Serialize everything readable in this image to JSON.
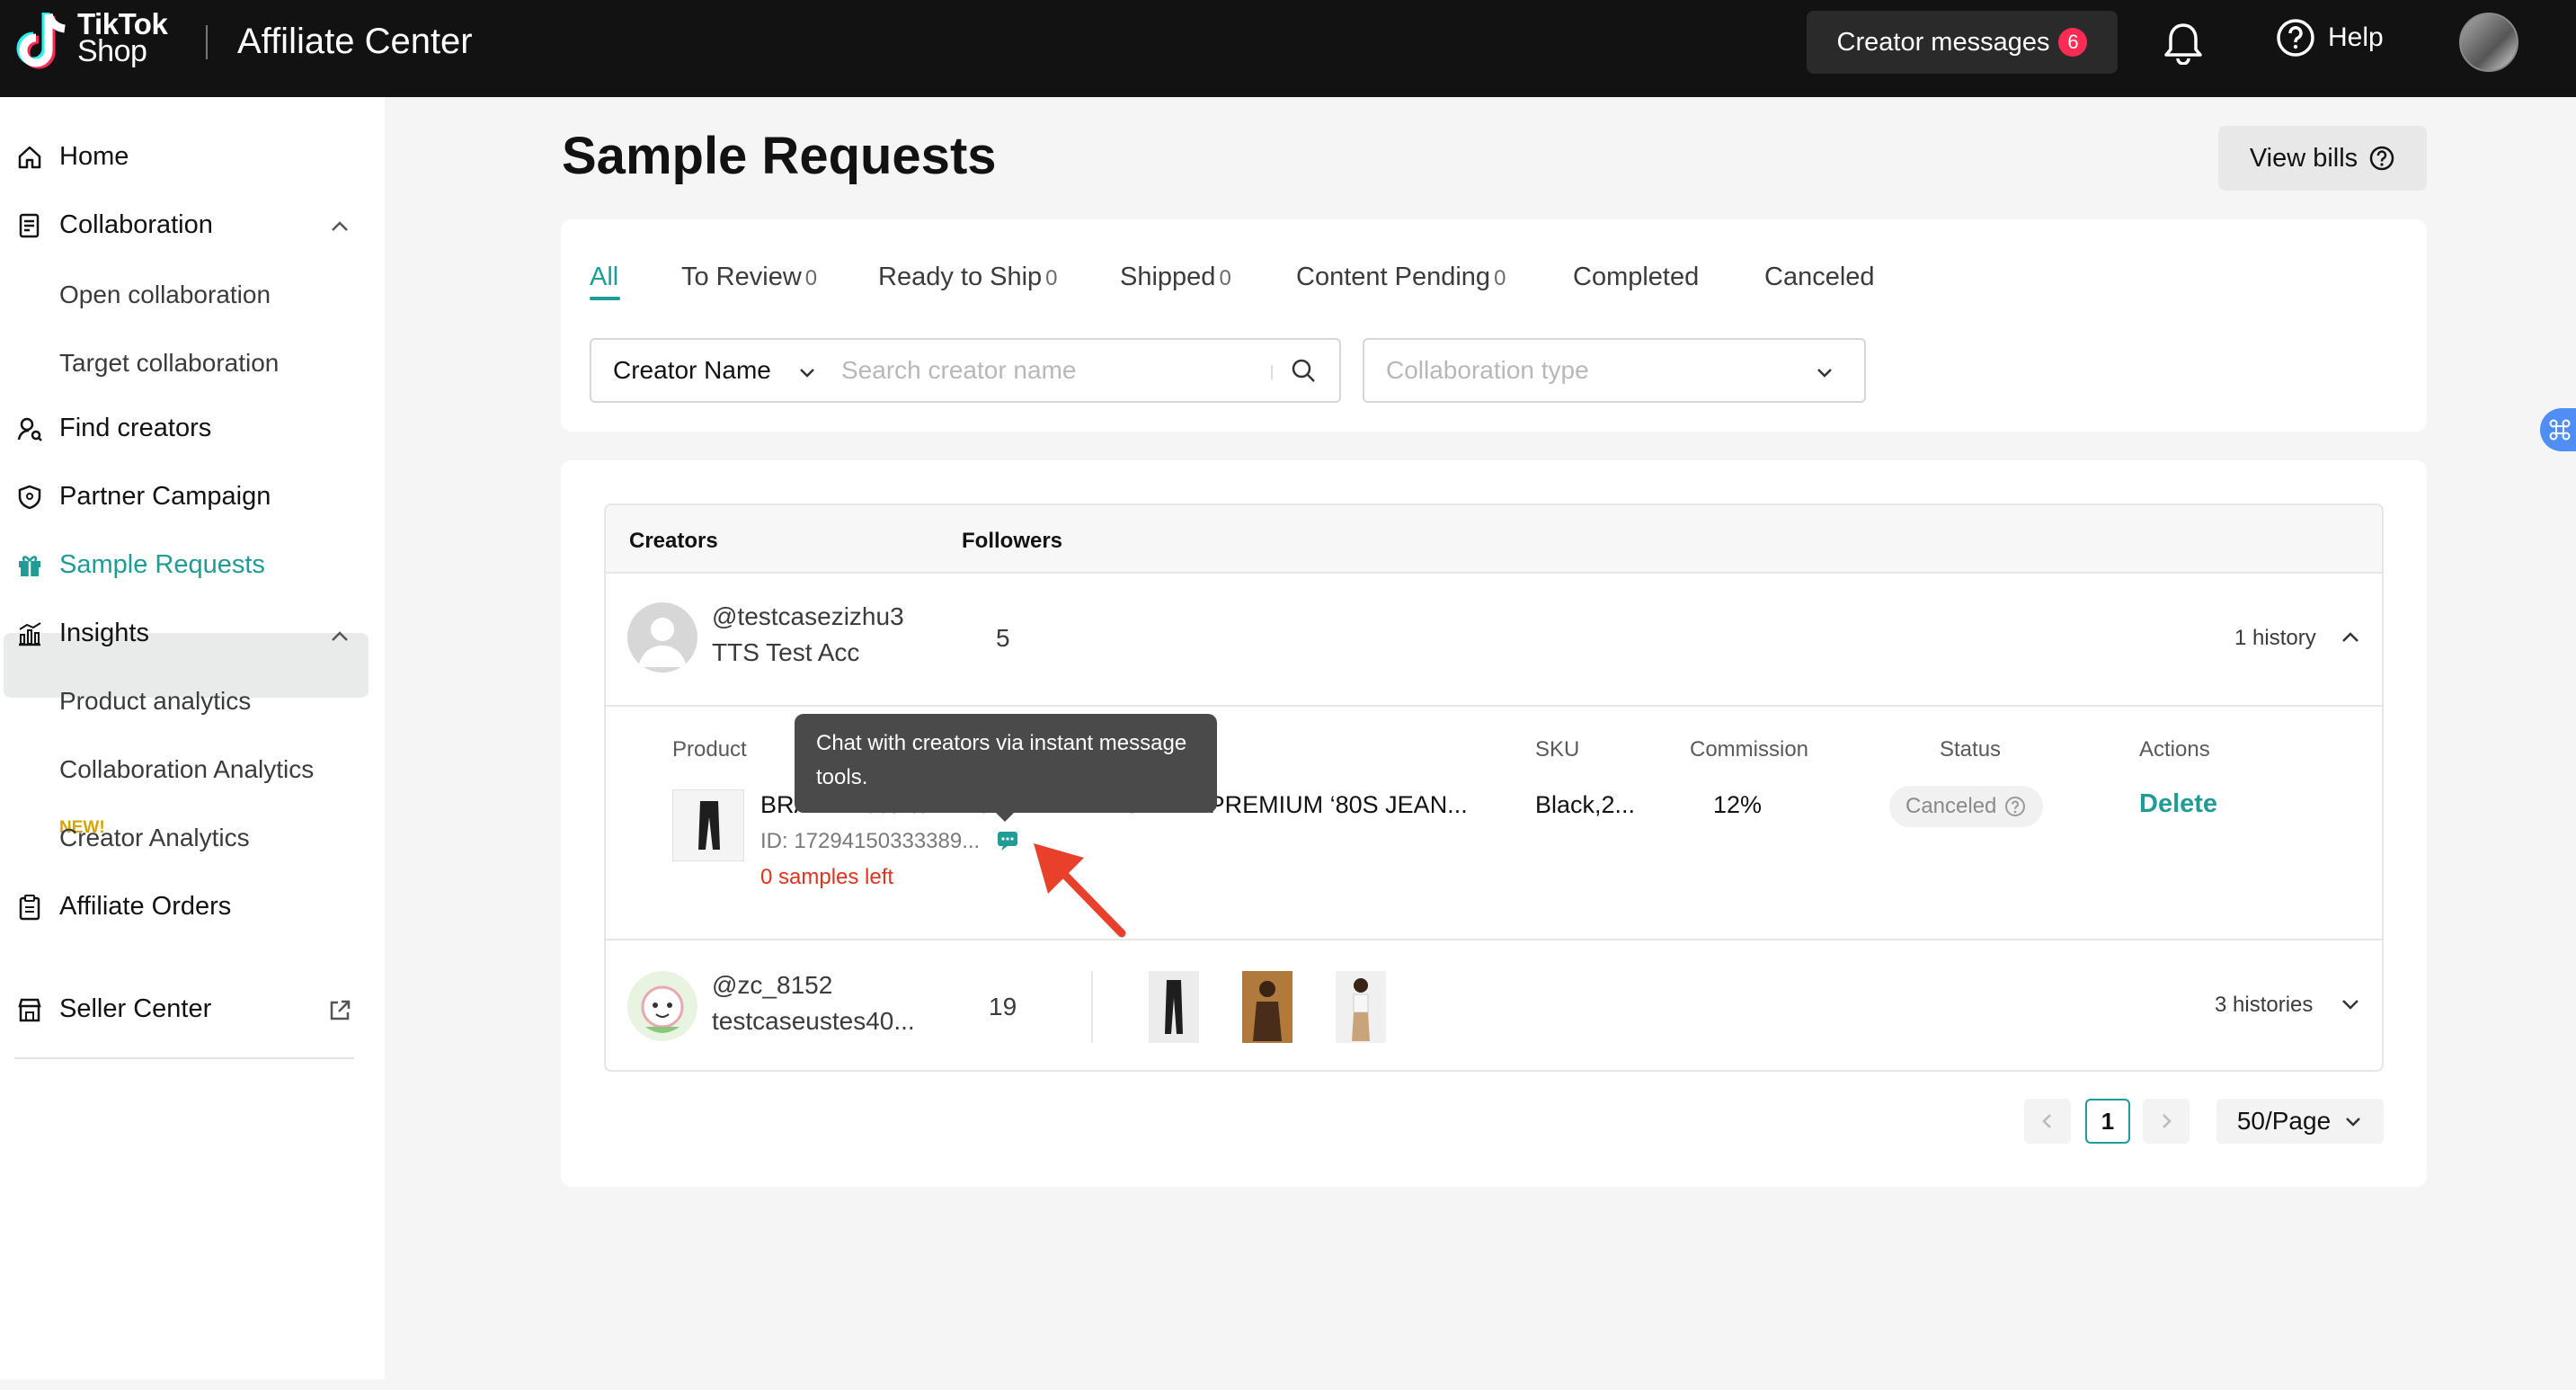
{
  "topbar": {
    "logo_line1": "TikTok",
    "logo_line2": "Shop",
    "app_title": "Affiliate Center",
    "creator_messages_label": "Creator messages",
    "creator_messages_count": "6",
    "help_label": "Help"
  },
  "sidebar": {
    "home": "Home",
    "collaboration": "Collaboration",
    "open_collaboration": "Open collaboration",
    "target_collaboration": "Target collaboration",
    "find_creators": "Find creators",
    "partner_campaign": "Partner Campaign",
    "sample_requests": "Sample Requests",
    "insights": "Insights",
    "product_analytics": "Product analytics",
    "new_tag": "NEW!",
    "collaboration_analytics": "Collaboration Analytics",
    "creator_analytics": "Creator Analytics",
    "affiliate_orders": "Affiliate Orders",
    "seller_center": "Seller Center"
  },
  "page": {
    "title": "Sample Requests",
    "view_bills": "View bills"
  },
  "tabs": [
    {
      "label": "All",
      "count": ""
    },
    {
      "label": "To Review",
      "count": "0"
    },
    {
      "label": "Ready to Ship",
      "count": "0"
    },
    {
      "label": "Shipped",
      "count": "0"
    },
    {
      "label": "Content Pending",
      "count": "0"
    },
    {
      "label": "Completed",
      "count": ""
    },
    {
      "label": "Canceled",
      "count": ""
    }
  ],
  "filters": {
    "creator_select": "Creator Name",
    "search_placeholder": "Search creator name",
    "collab_type_placeholder": "Collaboration type"
  },
  "table": {
    "col_creators": "Creators",
    "col_followers": "Followers",
    "rows": [
      {
        "handle": "@testcasezizhu3",
        "name": "TTS Test Acc",
        "followers": "5",
        "history": "1 history"
      },
      {
        "handle": "@zc_8152",
        "name": "testcaseustes40...",
        "followers": "19",
        "history": "3 histories"
      }
    ],
    "detail": {
      "col_product": "Product",
      "col_sku": "SKU",
      "col_commission": "Commission",
      "col_status": "Status",
      "col_actions": "Actions",
      "product_name": "BRAND Test Item NO EDIT PLEASE EW PREMIUM ‘80S JEAN...",
      "product_id": "ID: 17294150333389...",
      "samples_left": "0 samples left",
      "sku": "Black,2...",
      "commission": "12%",
      "status": "Canceled",
      "action": "Delete"
    }
  },
  "tooltip": {
    "text": "Chat with creators via instant message tools."
  },
  "pagination": {
    "current_page": "1",
    "page_size": "50/Page"
  },
  "colors": {
    "accent": "#1f9c96",
    "danger": "#e0321e",
    "badge": "#fe2c55",
    "topbar": "#121212"
  }
}
